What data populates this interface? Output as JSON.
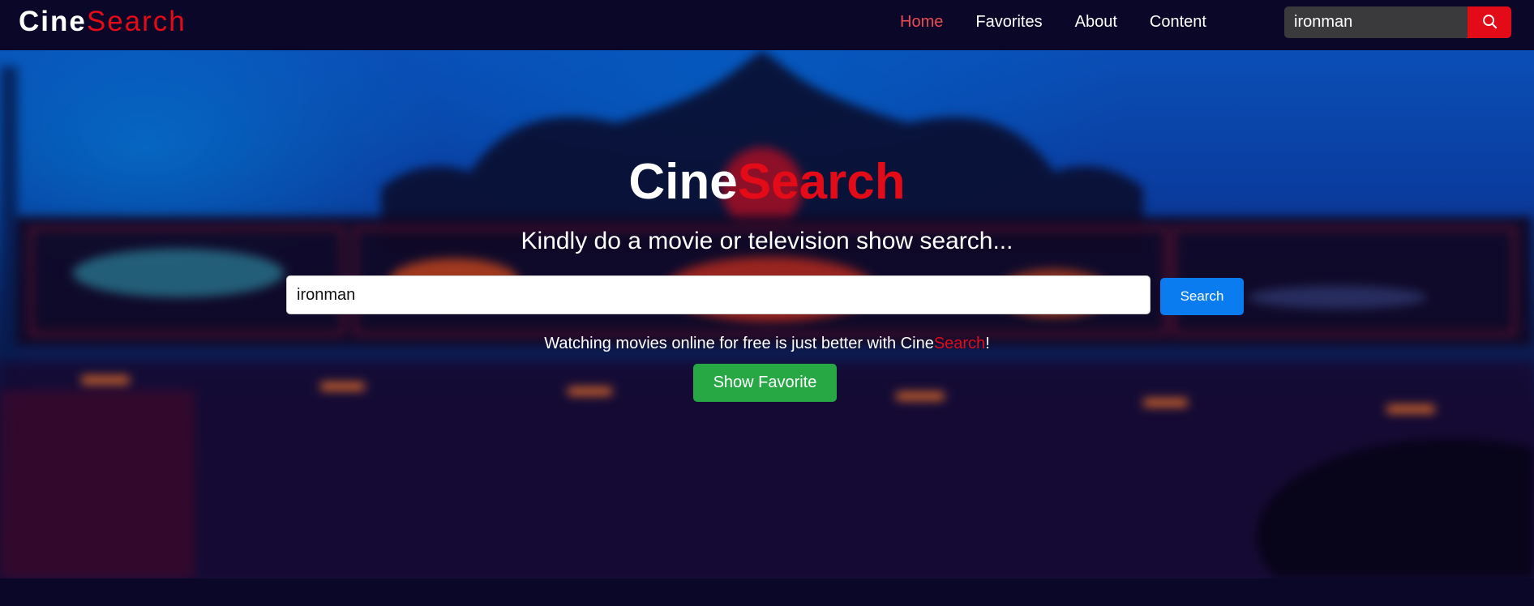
{
  "navbar": {
    "brand_part1": "Cine",
    "brand_part2": "Search",
    "links": [
      {
        "label": "Home",
        "active": true
      },
      {
        "label": "Favorites",
        "active": false
      },
      {
        "label": "About",
        "active": false
      },
      {
        "label": "Content",
        "active": false
      }
    ],
    "search": {
      "value": "ironman",
      "button_icon": "search-icon"
    }
  },
  "hero": {
    "title_part1": "Cine",
    "title_part2": "Search",
    "subtitle": "Kindly do a movie or television show search...",
    "search_value": "ironman",
    "search_button": "Search",
    "tagline_before": "Watching movies online for free is just better with Cine",
    "tagline_red": "Search",
    "tagline_after": "!",
    "show_favorite_button": "Show Favorite"
  },
  "colors": {
    "brand_red": "#e30b17",
    "navbar_bg": "#0b0728",
    "active_link": "#ec4b53",
    "search_button_blue": "#0b7cf0",
    "favorite_button_green": "#28a745"
  }
}
